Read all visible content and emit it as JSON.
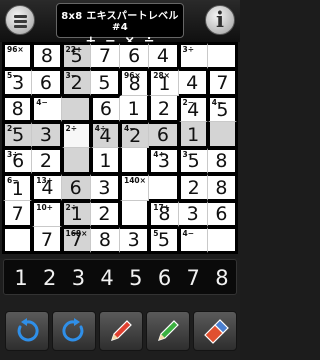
{
  "header": {
    "title": "8x8 エキスパートレベル #4",
    "operators": "+ − × ÷",
    "menu_icon": "hamburger-menu-icon",
    "info_icon": "info-icon"
  },
  "board": {
    "size": 8,
    "cells": [
      [
        {
          "label": "96×",
          "v": ""
        },
        {
          "label": "",
          "v": "8"
        },
        {
          "label": "22+",
          "v": "5"
        },
        {
          "label": "",
          "v": "7"
        },
        {
          "label": "",
          "v": "6"
        },
        {
          "label": "",
          "v": "4"
        },
        {
          "label": "3÷",
          "v": ""
        },
        {
          "label": "",
          "v": ""
        }
      ],
      [
        {
          "label": "5−",
          "v": "3"
        },
        {
          "label": "",
          "v": "6"
        },
        {
          "label": "3−",
          "v": "2"
        },
        {
          "label": "",
          "v": "5"
        },
        {
          "label": "96×",
          "v": "8"
        },
        {
          "label": "28×",
          "v": "1"
        },
        {
          "label": "",
          "v": "4"
        },
        {
          "label": "",
          "v": "7"
        }
      ],
      [
        {
          "label": "",
          "v": "8"
        },
        {
          "label": "4−",
          "v": ""
        },
        {
          "label": "",
          "v": ""
        },
        {
          "label": "",
          "v": "6"
        },
        {
          "label": "",
          "v": "1"
        },
        {
          "label": "",
          "v": "2"
        },
        {
          "label": "2−",
          "v": "4"
        },
        {
          "label": "4−",
          "v": "5"
        }
      ],
      [
        {
          "label": "2−",
          "v": "5"
        },
        {
          "label": "",
          "v": "3"
        },
        {
          "label": "2÷",
          "v": ""
        },
        {
          "label": "4÷",
          "v": "4"
        },
        {
          "label": "4−",
          "v": "2"
        },
        {
          "label": "",
          "v": "6"
        },
        {
          "label": "",
          "v": "1"
        },
        {
          "label": "",
          "v": ""
        }
      ],
      [
        {
          "label": "3÷",
          "v": "6"
        },
        {
          "label": "",
          "v": "2"
        },
        {
          "label": "",
          "v": ""
        },
        {
          "label": "",
          "v": "1"
        },
        {
          "label": "",
          "v": ""
        },
        {
          "label": "4÷",
          "v": "3"
        },
        {
          "label": "3−",
          "v": "5"
        },
        {
          "label": "",
          "v": "8"
        }
      ],
      [
        {
          "label": "6−",
          "v": "1"
        },
        {
          "label": "13+",
          "v": "4"
        },
        {
          "label": "",
          "v": "6"
        },
        {
          "label": "",
          "v": "3"
        },
        {
          "label": "140×",
          "v": ""
        },
        {
          "label": "",
          "v": ""
        },
        {
          "label": "",
          "v": "2"
        },
        {
          "label": "",
          "v": "8"
        }
      ],
      [
        {
          "label": "",
          "v": "7"
        },
        {
          "label": "10+",
          "v": ""
        },
        {
          "label": "2÷",
          "v": "1"
        },
        {
          "label": "",
          "v": "2"
        },
        {
          "label": "",
          "v": ""
        },
        {
          "label": "17+",
          "v": "8"
        },
        {
          "label": "",
          "v": "3"
        },
        {
          "label": "",
          "v": "6"
        }
      ],
      [
        {
          "label": "",
          "v": ""
        },
        {
          "label": "",
          "v": "7"
        },
        {
          "label": "168×",
          "v": "7"
        },
        {
          "label": "",
          "v": "8"
        },
        {
          "label": "",
          "v": "3"
        },
        {
          "label": "5",
          "v": "5"
        },
        {
          "label": "4−",
          "v": ""
        },
        {
          "label": "",
          "v": ""
        }
      ]
    ]
  },
  "numpad": {
    "digits": [
      "1",
      "2",
      "3",
      "4",
      "5",
      "6",
      "7",
      "8"
    ],
    "tools": [
      {
        "name": "undo-icon",
        "color": "#2f8fe8"
      },
      {
        "name": "redo-icon",
        "color": "#2f8fe8"
      },
      {
        "name": "red-pencil-icon",
        "color": "#e04030"
      },
      {
        "name": "green-pencil-icon",
        "color": "#3cb040"
      },
      {
        "name": "eraser-icon",
        "color": "#e05030"
      }
    ]
  }
}
